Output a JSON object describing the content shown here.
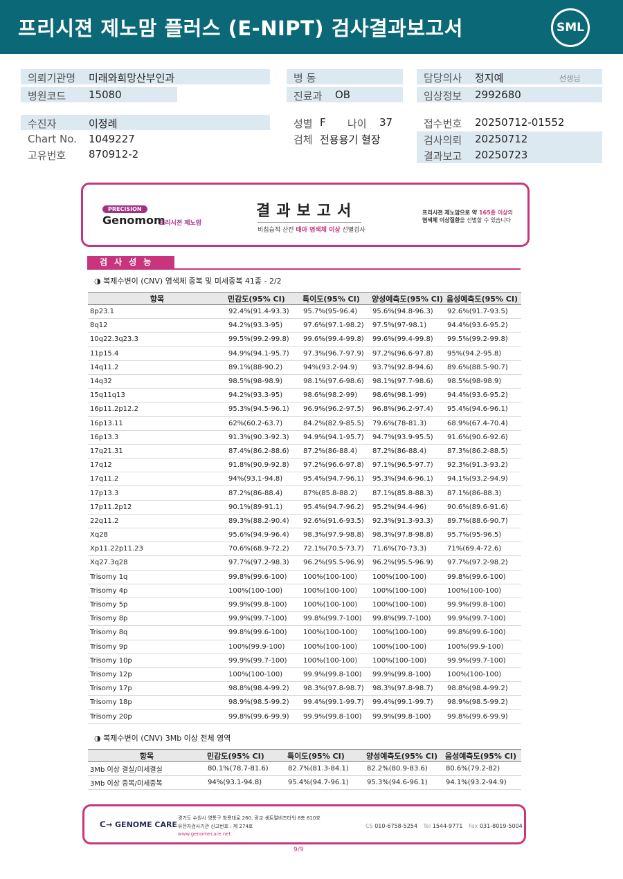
{
  "header": {
    "title": "프리시젼 제노맘 플러스 (E-NIPT) 검사결과보고서",
    "logo_text": "SML"
  },
  "info": {
    "institution": {
      "label": "의뢰기관명",
      "value": "미래와희망산부인과"
    },
    "hospital_code": {
      "label": "병원코드",
      "value": "15080"
    },
    "ward": {
      "label": "병  동",
      "value": ""
    },
    "department": {
      "label": "진료과",
      "value": "OB"
    },
    "doctor": {
      "label": "담당의사",
      "value": "정지예",
      "suffix": "선생님"
    },
    "clinical_info": {
      "label": "임상정보",
      "value": "2992680"
    },
    "patient": {
      "label": "수진자",
      "value": "이정례"
    },
    "chart_no": {
      "label": "Chart No.",
      "value": "1049227"
    },
    "unique_no": {
      "label": "고유번호",
      "value": "870912-2"
    },
    "sex": {
      "label": "성별",
      "value": "F"
    },
    "age": {
      "label": "나이",
      "value": "37"
    },
    "specimen": {
      "label": "검체",
      "value": "전용용기 혈장"
    },
    "receipt_no": {
      "label": "접수번호",
      "value": "20250712-01552"
    },
    "test_request": {
      "label": "검사의뢰",
      "value": "20250712"
    },
    "result_report": {
      "label": "결과보고",
      "value": "20250723"
    }
  },
  "report_header": {
    "precision_badge": "PRECISION",
    "brand": "Genomom",
    "brand_kr": "프리시젼 제노맘",
    "title": "결과보고서",
    "subtitle_a": "비침습적 산전 ",
    "subtitle_highlight": "태아 염색체 이상",
    "subtitle_b": " 선별검사",
    "right_line1_a": "프리시젼 제노맘으로 약 ",
    "right_line1_highlight": "165종 이상",
    "right_line1_b": "의",
    "right_line2_a": "염색체 이상질환",
    "right_line2_b": "을 선별할 수 있습니다"
  },
  "section": {
    "title": "검사성능",
    "sub1": "◑ 복제수변이 (CNV) 염색체 중복 및 미세중복 41종 - 2/2",
    "sub2": "◑ 복제수변이 (CNV) 3Mb 이상 전체 영역"
  },
  "table1": {
    "headers": [
      "항목",
      "민감도(95% CI)",
      "특이도(95% CI)",
      "양성예측도(95% CI)",
      "음성예측도(95% CI)"
    ],
    "rows": [
      [
        "8p23.1",
        "92.4%(91.4-93.3)",
        "95.7%(95-96.4)",
        "95.6%(94.8-96.3)",
        "92.6%(91.7-93.5)"
      ],
      [
        "8q12",
        "94.2%(93.3-95)",
        "97.6%(97.1-98.2)",
        "97.5%(97-98.1)",
        "94.4%(93.6-95.2)"
      ],
      [
        "10q22.3q23.3",
        "99.5%(99.2-99.8)",
        "99.6%(99.4-99.8)",
        "99.6%(99.4-99.8)",
        "99.5%(99.2-99.8)"
      ],
      [
        "11p15.4",
        "94.9%(94.1-95.7)",
        "97.3%(96.7-97.9)",
        "97.2%(96.6-97.8)",
        "95%(94.2-95.8)"
      ],
      [
        "14q11.2",
        "89.1%(88-90.2)",
        "94%(93.2-94.9)",
        "93.7%(92.8-94.6)",
        "89.6%(88.5-90.7)"
      ],
      [
        "14q32",
        "98.5%(98-98.9)",
        "98.1%(97.6-98.6)",
        "98.1%(97.7-98.6)",
        "98.5%(98-98.9)"
      ],
      [
        "15q11q13",
        "94.2%(93.3-95)",
        "98.6%(98.2-99)",
        "98.6%(98.1-99)",
        "94.4%(93.6-95.2)"
      ],
      [
        "16p11.2p12.2",
        "95.3%(94.5-96.1)",
        "96.9%(96.2-97.5)",
        "96.8%(96.2-97.4)",
        "95.4%(94.6-96.1)"
      ],
      [
        "16p13.11",
        "62%(60.2-63.7)",
        "84.2%(82.9-85.5)",
        "79.6%(78-81.3)",
        "68.9%(67.4-70.4)"
      ],
      [
        "16p13.3",
        "91.3%(90.3-92.3)",
        "94.9%(94.1-95.7)",
        "94.7%(93.9-95.5)",
        "91.6%(90.6-92.6)"
      ],
      [
        "17q21.31",
        "87.4%(86.2-88.6)",
        "87.2%(86-88.4)",
        "87.2%(86-88.4)",
        "87.3%(86.2-88.5)"
      ],
      [
        "17q12",
        "91.8%(90.9-92.8)",
        "97.2%(96.6-97.8)",
        "97.1%(96.5-97.7)",
        "92.3%(91.3-93.2)"
      ],
      [
        "17q11.2",
        "94%(93.1-94.8)",
        "95.4%(94.7-96.1)",
        "95.3%(94.6-96.1)",
        "94.1%(93.2-94.9)"
      ],
      [
        "17p13.3",
        "87.2%(86-88.4)",
        "87%(85.8-88.2)",
        "87.1%(85.8-88.3)",
        "87.1%(86-88.3)"
      ],
      [
        "17p11.2p12",
        "90.1%(89-91.1)",
        "95.4%(94.7-96.2)",
        "95.2%(94.4-96)",
        "90.6%(89.6-91.6)"
      ],
      [
        "22q11.2",
        "89.3%(88.2-90.4)",
        "92.6%(91.6-93.5)",
        "92.3%(91.3-93.3)",
        "89.7%(88.6-90.7)"
      ],
      [
        "Xq28",
        "95.6%(94.9-96.4)",
        "98.3%(97.9-98.8)",
        "98.3%(97.8-98.8)",
        "95.7%(95-96.5)"
      ],
      [
        "Xp11.22p11.23",
        "70.6%(68.9-72.2)",
        "72.1%(70.5-73.7)",
        "71.6%(70-73.3)",
        "71%(69.4-72.6)"
      ],
      [
        "Xq27.3q28",
        "97.7%(97.2-98.3)",
        "96.2%(95.5-96.9)",
        "96.2%(95.5-96.9)",
        "97.7%(97.2-98.2)"
      ],
      [
        "Trisomy 1q",
        "99.8%(99.6-100)",
        "100%(100-100)",
        "100%(100-100)",
        "99.8%(99.6-100)"
      ],
      [
        "Trisomy 4p",
        "100%(100-100)",
        "100%(100-100)",
        "100%(100-100)",
        "100%(100-100)"
      ],
      [
        "Trisomy 5p",
        "99.9%(99.8-100)",
        "100%(100-100)",
        "100%(100-100)",
        "99.9%(99.8-100)"
      ],
      [
        "Trisomy 8p",
        "99.9%(99.7-100)",
        "99.8%(99.7-100)",
        "99.8%(99.7-100)",
        "99.9%(99.7-100)"
      ],
      [
        "Trisomy 8q",
        "99.8%(99.6-100)",
        "100%(100-100)",
        "100%(100-100)",
        "99.8%(99.6-100)"
      ],
      [
        "Trisomy 9p",
        "100%(99.9-100)",
        "100%(100-100)",
        "100%(100-100)",
        "100%(99.9-100)"
      ],
      [
        "Trisomy 10p",
        "99.9%(99.7-100)",
        "100%(100-100)",
        "100%(100-100)",
        "99.9%(99.7-100)"
      ],
      [
        "Trisomy 12p",
        "100%(100-100)",
        "99.9%(99.8-100)",
        "99.9%(99.8-100)",
        "100%(100-100)"
      ],
      [
        "Trisomy 17p",
        "98.8%(98.4-99.2)",
        "98.3%(97.8-98.7)",
        "98.3%(97.8-98.7)",
        "98.8%(98.4-99.2)"
      ],
      [
        "Trisomy 18p",
        "98.9%(98.5-99.2)",
        "99.4%(99.1-99.7)",
        "99.4%(99.1-99.7)",
        "98.9%(98.5-99.2)"
      ],
      [
        "Trisomy 20p",
        "99.8%(99.6-99.9)",
        "99.9%(99.8-100)",
        "99.9%(99.8-100)",
        "99.8%(99.6-99.9)"
      ]
    ]
  },
  "table2": {
    "headers": [
      "항목",
      "민감도(95% CI)",
      "특이도(95% CI)",
      "양성예측도(95% CI)",
      "음성예측도(95% CI)"
    ],
    "rows": [
      [
        "3Mb 이상 결실/미세결실",
        "80.1%(78.7-81.6)",
        "82.7%(81.3-84.1)",
        "82.2%(80.9-83.6)",
        "80.6%(79.2-82)"
      ],
      [
        "3Mb 이상 중복/미세중복",
        "94%(93.1-94.8)",
        "95.4%(94.7-96.1)",
        "95.3%(94.6-96.1)",
        "94.1%(93.2-94.9)"
      ]
    ]
  },
  "footer": {
    "logo": "GENOME CARE",
    "address": "경기도 수원시 영통구 창룡대로 260, 광교 센트럴비즈타워 8층 810호",
    "license": "유전자검사기관 신고번호 : 제 274호",
    "url": "www.genomecare.net",
    "cs_label": "CS",
    "cs": "010-6758-5254",
    "tel_label": "Tel",
    "tel": "1544-9771",
    "fax_label": "Fax",
    "fax": "031-8019-5004",
    "page": "9/9"
  }
}
